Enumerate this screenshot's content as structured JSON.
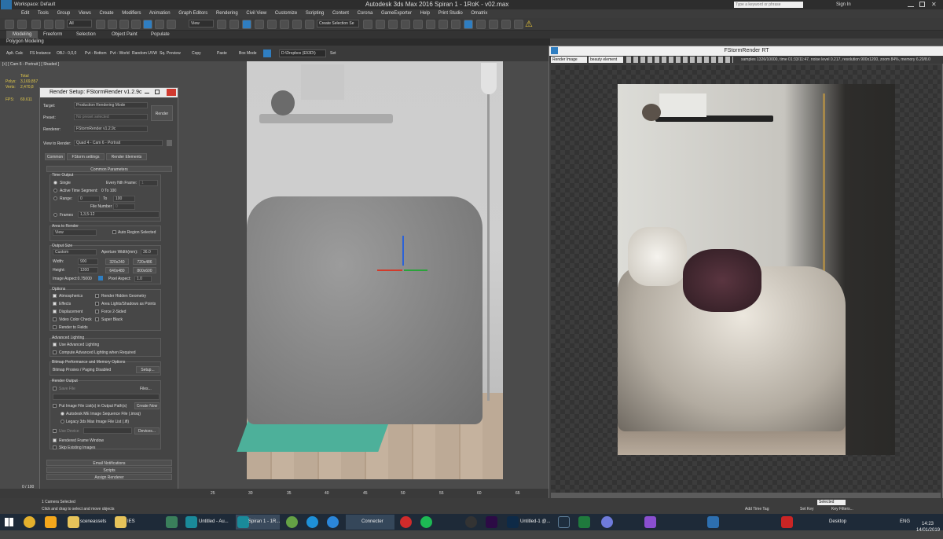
{
  "app": {
    "title": "Autodesk 3ds Max 2016    Spiran 1 - 1RoK - v02.max",
    "workspace": "Workspace: Default",
    "search_placeholder": "Type a keyword or phrase",
    "sign_in": "Sign In"
  },
  "menu": [
    "Edit",
    "Tools",
    "Group",
    "Views",
    "Create",
    "Modifiers",
    "Animation",
    "Graph Editors",
    "Rendering",
    "Civil View",
    "Customize",
    "Scripting",
    "Content",
    "Corona",
    "GameExporter",
    "Help",
    "Print Studio",
    "Omatrix"
  ],
  "toolbar": {
    "selection_filter": "All",
    "view_label": "View",
    "selection_set": "Create Selection Se"
  },
  "ribbon": {
    "tabs": [
      "Modeling",
      "Freeform",
      "Selection",
      "Object Paint",
      "Populate"
    ],
    "sub": "Polygon Modeling",
    "tools": [
      "Aplt. Calc",
      "FS Instance",
      "OBJ - 0,0,0",
      "Pvt - Bottom",
      "Pvt - World",
      "Random UVW",
      "Sq. Preview",
      "Copy",
      "Paste",
      "Box Mode"
    ],
    "path": "D:\\Dropbox (El\\3D\\)",
    "set": "Set"
  },
  "viewport": {
    "label": "[+] [ Cam 6 - Portrait ] [ Shaded ]",
    "stats": {
      "total": "Total",
      "polys_label": "Polys:",
      "polys": "3,169,857",
      "verts_label": "Verts:",
      "verts": "2,470,8",
      "fps_label": "FPS:",
      "fps": "69.611"
    }
  },
  "render_setup": {
    "title": "Render Setup: FStormRender v1.2.9c",
    "target_label": "Target:",
    "target": "Production Rendering Mode",
    "preset_label": "Preset:",
    "preset": "No preset selected",
    "renderer_label": "Renderer:",
    "renderer": "FStormRender v1.2.9c",
    "view_label": "View to Render:",
    "view": "Quad 4 - Cam 6 - Portrait",
    "render_button": "Render",
    "tabs": [
      "Common",
      "FStorm settings",
      "Render Elements"
    ],
    "common_params": "Common Parameters",
    "time_output": "Time Output",
    "single": "Single",
    "every_nth": "Every Nth Frame:",
    "every_nth_value": "1",
    "active_segment": "Active Time Segment:",
    "active_range": "0 To 100",
    "range_label": "Range:",
    "range_from": "0",
    "range_to_label": "To",
    "range_to": "100",
    "file_number_base": "File Number Base:",
    "file_number_value": "0",
    "frames_label": "Frames",
    "frames_value": "1,3,5-12",
    "area_to_render": "Area to Render",
    "area_value": "View",
    "auto_region": "Auto Region Selected",
    "output_size": "Output Size",
    "size_preset": "Custom",
    "aperture_label": "Aperture Width(mm):",
    "aperture": "36.0",
    "width_label": "Width:",
    "width": "900",
    "height_label": "Height:",
    "height": "1200",
    "presets": [
      "320x240",
      "720x486",
      "640x480",
      "800x600"
    ],
    "image_aspect": "Image Aspect:0.75000",
    "pixel_aspect_label": "Pixel Aspect:",
    "pixel_aspect": "1.0",
    "options": "Options",
    "opt_left": [
      "Atmospherics",
      "Effects",
      "Displacement",
      "Video Color Check",
      "Render to Fields"
    ],
    "opt_right": [
      "Render Hidden Geometry",
      "Area Lights/Shadows as Points",
      "Force 2-Sided",
      "Super Black"
    ],
    "adv_lighting": "Advanced Lighting",
    "use_adv": "Use Advanced Lighting",
    "compute_adv": "Compute Advanced Lighting when Required",
    "bitmap_perf": "Bitmap Performance and Memory Options",
    "bitmap_status": "Bitmap Proxies / Paging Disabled",
    "setup": "Setup...",
    "render_output": "Render Output",
    "save_file": "Save File",
    "files": "Files...",
    "put_image": "Put Image File List(s) in Output Path(s)",
    "create_now": "Create Now",
    "autodesk_seq": "Autodesk ME Image Sequence File (.imsq)",
    "legacy": "Legacy 3ds Max Image File List (.ifl)",
    "use_device": "Use Device",
    "devices": "Devices...",
    "rendered_frame_window": "Rendered Frame Window",
    "skip_existing": "Skip Existing Images",
    "email": "Email Notifications",
    "scripts": "Scripts",
    "assign": "Assign Renderer"
  },
  "fstorm": {
    "title": "FStormRender RT",
    "channel": "Render Image",
    "element": "beauty element",
    "info": "samples 1326/10000, time 01:33/11:47, noise level 0.217, resolution 900x1200, zoom 84%, memory 6.20/8.0"
  },
  "timeline": {
    "ticks": [
      "25",
      "30",
      "35",
      "40",
      "45",
      "50",
      "55",
      "60",
      "65"
    ],
    "frame": "0 / 100"
  },
  "status": {
    "selected": "1 Camera Selected",
    "hint": "Click and drag to select and move objects",
    "add_time_tag": "Add Time Tag",
    "set_key": "Set Key",
    "key_filters": "Key Filters...",
    "selected_mode": "Selected"
  },
  "taskbar": {
    "items": [
      "sceneassets",
      "IES",
      "Untitled - Au...",
      "Spiran 1 - 1R...",
      "Connecter",
      "Untitled-1 @...",
      "Desktop"
    ],
    "lang": "ENG",
    "time": "14:23",
    "date": "14/01/2019"
  },
  "colors": {
    "accent_blue": "#2f7ec1",
    "close_red": "#d03a2f",
    "fstorm_bg": "#3f3f3f"
  }
}
